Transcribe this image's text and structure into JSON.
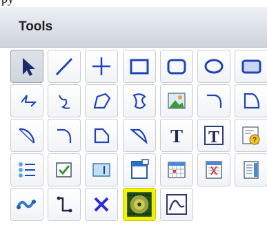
{
  "panel": {
    "title": "Tools"
  },
  "colors": {
    "accent_blue": "#1e44b8",
    "selected_highlight": "#f3f300"
  },
  "tools": [
    {
      "name": "pointer-tool",
      "icon": "arrow-pointer-icon",
      "state": "pressed"
    },
    {
      "name": "line-tool",
      "icon": "diagonal-line-icon"
    },
    {
      "name": "crosshair-tool",
      "icon": "plus-icon"
    },
    {
      "name": "rectangle-tool",
      "icon": "rectangle-icon"
    },
    {
      "name": "rounded-rectangle-tool",
      "icon": "rounded-rectangle-icon"
    },
    {
      "name": "ellipse-tool",
      "icon": "ellipse-icon"
    },
    {
      "name": "shaded-rectangle-tool",
      "icon": "shaded-rectangle-icon"
    },
    {
      "name": "zigzag-line-tool",
      "icon": "zigzag-icon"
    },
    {
      "name": "freehand-curve-tool",
      "icon": "freehand-curve-icon"
    },
    {
      "name": "polygon-tool",
      "icon": "polygon-icon"
    },
    {
      "name": "freehand-shape-tool",
      "icon": "freehand-shape-icon"
    },
    {
      "name": "image-tool",
      "icon": "image-icon"
    },
    {
      "name": "arc-tool",
      "icon": "arc-icon"
    },
    {
      "name": "curved-shape-tool",
      "icon": "curved-shape-icon"
    },
    {
      "name": "diagonal-arc-tool",
      "icon": "diagonal-arc-icon"
    },
    {
      "name": "elbow-arc-tool",
      "icon": "elbow-arc-icon"
    },
    {
      "name": "cut-corner-tool",
      "icon": "cut-corner-icon"
    },
    {
      "name": "slanted-arc-tool",
      "icon": "slanted-arc-icon"
    },
    {
      "name": "text-tool",
      "icon": "text-icon",
      "label": "T"
    },
    {
      "name": "text-box-tool",
      "icon": "text-box-icon",
      "label": "T"
    },
    {
      "name": "callout-tool",
      "icon": "callout-icon"
    },
    {
      "name": "list-tool",
      "icon": "list-icon"
    },
    {
      "name": "checkbox-tool",
      "icon": "checkbox-icon"
    },
    {
      "name": "text-field-tool",
      "icon": "text-field-icon"
    },
    {
      "name": "dialog-tool",
      "icon": "dialog-icon"
    },
    {
      "name": "grid-tool",
      "icon": "grid-icon"
    },
    {
      "name": "form-tool",
      "icon": "form-icon"
    },
    {
      "name": "scroll-panel-tool",
      "icon": "scroll-panel-icon"
    },
    {
      "name": "wave-tool",
      "icon": "wave-icon"
    },
    {
      "name": "step-line-tool",
      "icon": "step-line-icon"
    },
    {
      "name": "delete-tool",
      "icon": "x-icon"
    },
    {
      "name": "media-tool",
      "icon": "media-disc-icon",
      "state": "selected"
    },
    {
      "name": "curve-graph-tool",
      "icon": "curve-graph-icon"
    }
  ]
}
